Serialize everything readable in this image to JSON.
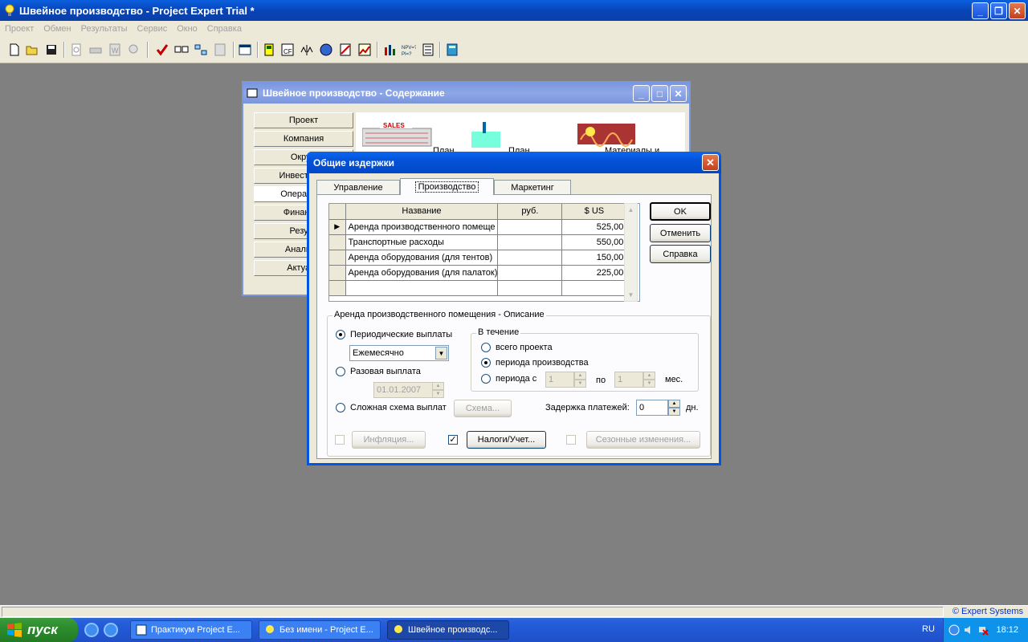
{
  "app": {
    "title": "Швейное производство - Project Expert Trial *",
    "menu": [
      "Проект",
      "Обмен",
      "Результаты",
      "Сервис",
      "Окно",
      "Справка"
    ],
    "status_credit": "© Expert Systems"
  },
  "contents_window": {
    "title": "Швейное производство - Содержание",
    "nav": [
      "Проект",
      "Компания",
      "Окруж",
      "Инвестицио",
      "Операцион",
      "Финансир",
      "Резуль",
      "Анализ п",
      "Актуали"
    ],
    "panel_labels": [
      "План",
      "План",
      "Материалы и"
    ],
    "sales_label": "SALES"
  },
  "dialog": {
    "title": "Общие издержки",
    "tabs": [
      "Управление",
      "Производство",
      "Маркетинг"
    ],
    "buttons": {
      "ok": "OK",
      "cancel": "Отменить",
      "help": "Справка"
    },
    "grid": {
      "headers": [
        "Название",
        "руб.",
        "$ US"
      ],
      "rows": [
        {
          "name": "Аренда производственного помеще",
          "rub": "",
          "usd": "525,00"
        },
        {
          "name": "Транспортные расходы",
          "rub": "",
          "usd": "550,00"
        },
        {
          "name": "Аренда оборудования (для тентов)",
          "rub": "",
          "usd": "150,00"
        },
        {
          "name": "Аренда оборудования (для палаток)",
          "rub": "",
          "usd": "225,00"
        }
      ]
    },
    "description_group": "Аренда производственного помещения - Описание",
    "periodic_label": "Периодические выплаты",
    "periodic_value": "Ежемесячно",
    "single_label": "Разовая выплата",
    "single_date": "01.01.2007",
    "complex_label": "Сложная схема выплат",
    "scheme_button": "Схема...",
    "during_group": "В течение",
    "during_whole": "всего проекта",
    "during_production": "периода производства",
    "during_from": "периода с",
    "from_value": "1",
    "to_label": "по",
    "to_value": "1",
    "months_label": "мес.",
    "delay_label": "Задержка платежей:",
    "delay_value": "0",
    "days_label": "дн.",
    "inflation_button": "Инфляция...",
    "taxes_button": "Налоги/Учет...",
    "seasonal_button": "Сезонные изменения..."
  },
  "taskbar": {
    "start": "пуск",
    "tasks": [
      "Практикум Project E...",
      "Без имени - Project E...",
      "Швейное производс..."
    ],
    "lang": "RU",
    "clock": "18:12"
  }
}
